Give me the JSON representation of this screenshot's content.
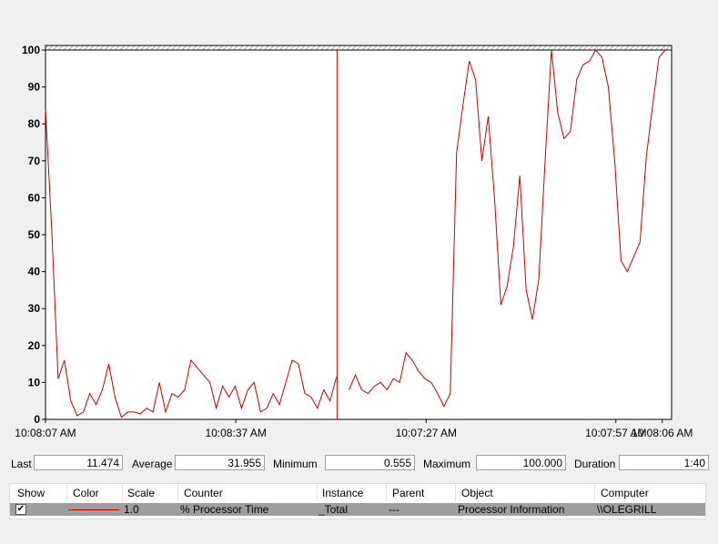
{
  "chart_data": {
    "type": "line",
    "title": "",
    "xlabel": "",
    "ylabel": "",
    "ylim": [
      0,
      100
    ],
    "y_ticks": [
      "100",
      "90",
      "80",
      "70",
      "60",
      "50",
      "40",
      "30",
      "20",
      "10",
      "0"
    ],
    "x_tick_labels": [
      "10:08:07 AM",
      "10:08:37 AM",
      "10:07:27 AM",
      "10:07:57 AM",
      "10:08:06 AM"
    ],
    "grid": false,
    "series": [
      {
        "color": "#cc0000",
        "segment_before_cursor": [
          84,
          51,
          11,
          16,
          5,
          1,
          2,
          7,
          4,
          8,
          15,
          6,
          0.55,
          2,
          2,
          1.5,
          3,
          2,
          10,
          2,
          7,
          6,
          8,
          16,
          14,
          12,
          10,
          3,
          9,
          6,
          9,
          3,
          8,
          10,
          2,
          3,
          7,
          4,
          10,
          16,
          15,
          7,
          6,
          3,
          8,
          5,
          11.474
        ],
        "segment_after_cursor": [
          8,
          12,
          8,
          7,
          9,
          10,
          8,
          11,
          10,
          18,
          16,
          13,
          11,
          10,
          7,
          3.5,
          7,
          72,
          85,
          97,
          92,
          70,
          82,
          60,
          31,
          36,
          47,
          66,
          35,
          27,
          38,
          70,
          100,
          83,
          76,
          78,
          92,
          96,
          97,
          100,
          98,
          90,
          70,
          43,
          40,
          44,
          48,
          71,
          85,
          98,
          100
        ]
      }
    ],
    "cursor_position_fraction": 0.466
  },
  "stats": {
    "last_label": "Last",
    "last_value": "11.474",
    "average_label": "Average",
    "average_value": "31.955",
    "minimum_label": "Minimum",
    "minimum_value": "0.555",
    "maximum_label": "Maximum",
    "maximum_value": "100.000",
    "duration_label": "Duration",
    "duration_value": "1:40"
  },
  "legend": {
    "columns": [
      "Show",
      "Color",
      "Scale",
      "Counter",
      "Instance",
      "Parent",
      "Object",
      "Computer"
    ],
    "rows": [
      {
        "show": "✔",
        "color": "#cc0000",
        "scale": "1.0",
        "counter": "% Processor Time",
        "instance": "_Total",
        "parent": "---",
        "object": "Processor Information",
        "computer": "\\\\OLEGRILL"
      }
    ]
  }
}
